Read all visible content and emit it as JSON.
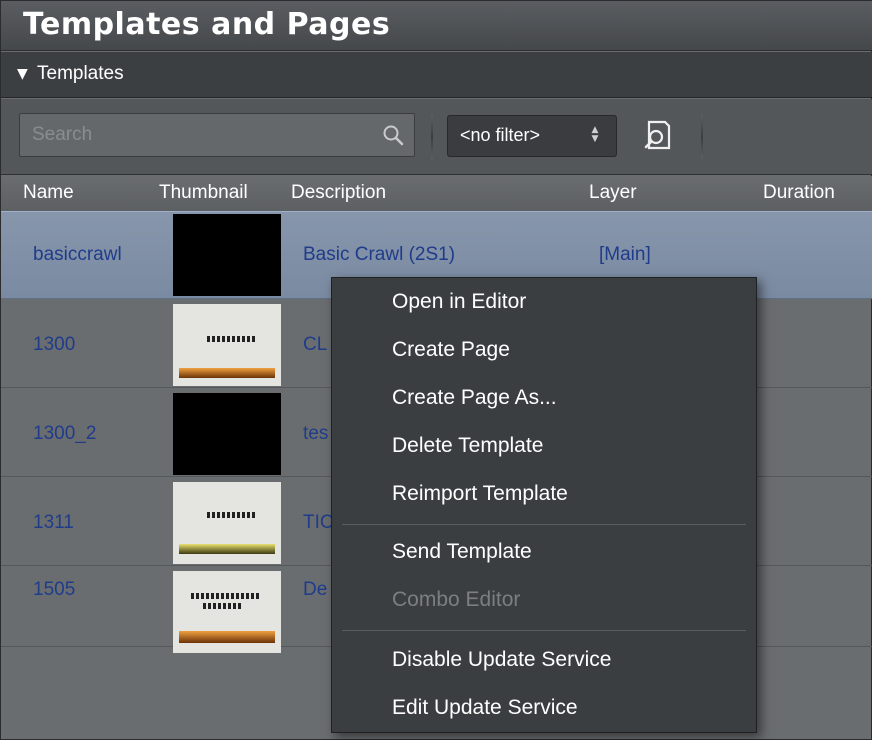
{
  "panel": {
    "title": "Templates and Pages",
    "section": {
      "arrow": "▼",
      "label": "Templates"
    }
  },
  "toolbar": {
    "search_placeholder": "Search",
    "filter_value": "<no filter>",
    "find_icon": "find-template-icon"
  },
  "table": {
    "columns": [
      "Name",
      "Thumbnail",
      "Description",
      "Layer",
      "Duration"
    ],
    "rows": [
      {
        "name": "basiccrawl",
        "description": "Basic Crawl (2S1)",
        "layer": "[Main]",
        "duration": ""
      },
      {
        "name": "1300",
        "description": "CL",
        "layer": "",
        "duration": ""
      },
      {
        "name": "1300_2",
        "description": "tes",
        "layer": "",
        "duration": ""
      },
      {
        "name": "1311",
        "description": "TIC",
        "layer": "",
        "duration": ""
      },
      {
        "name": "1505",
        "description": "De",
        "layer": "",
        "duration": ""
      }
    ]
  },
  "context_menu": {
    "items": [
      {
        "label": "Open in Editor",
        "enabled": true
      },
      {
        "label": "Create Page",
        "enabled": true
      },
      {
        "label": "Create Page As...",
        "enabled": true
      },
      {
        "label": "Delete Template",
        "enabled": true
      },
      {
        "label": "Reimport Template",
        "enabled": true
      },
      {
        "label": "Send Template",
        "enabled": true
      },
      {
        "label": "Combo Editor",
        "enabled": false
      },
      {
        "label": "Disable Update Service",
        "enabled": true
      },
      {
        "label": "Edit Update Service",
        "enabled": true
      }
    ]
  },
  "colors": {
    "selection": "#8192a8",
    "link_text": "#1f3c8a",
    "menu_bg": "#3b3e41",
    "disabled_text": "#7b7e82"
  }
}
